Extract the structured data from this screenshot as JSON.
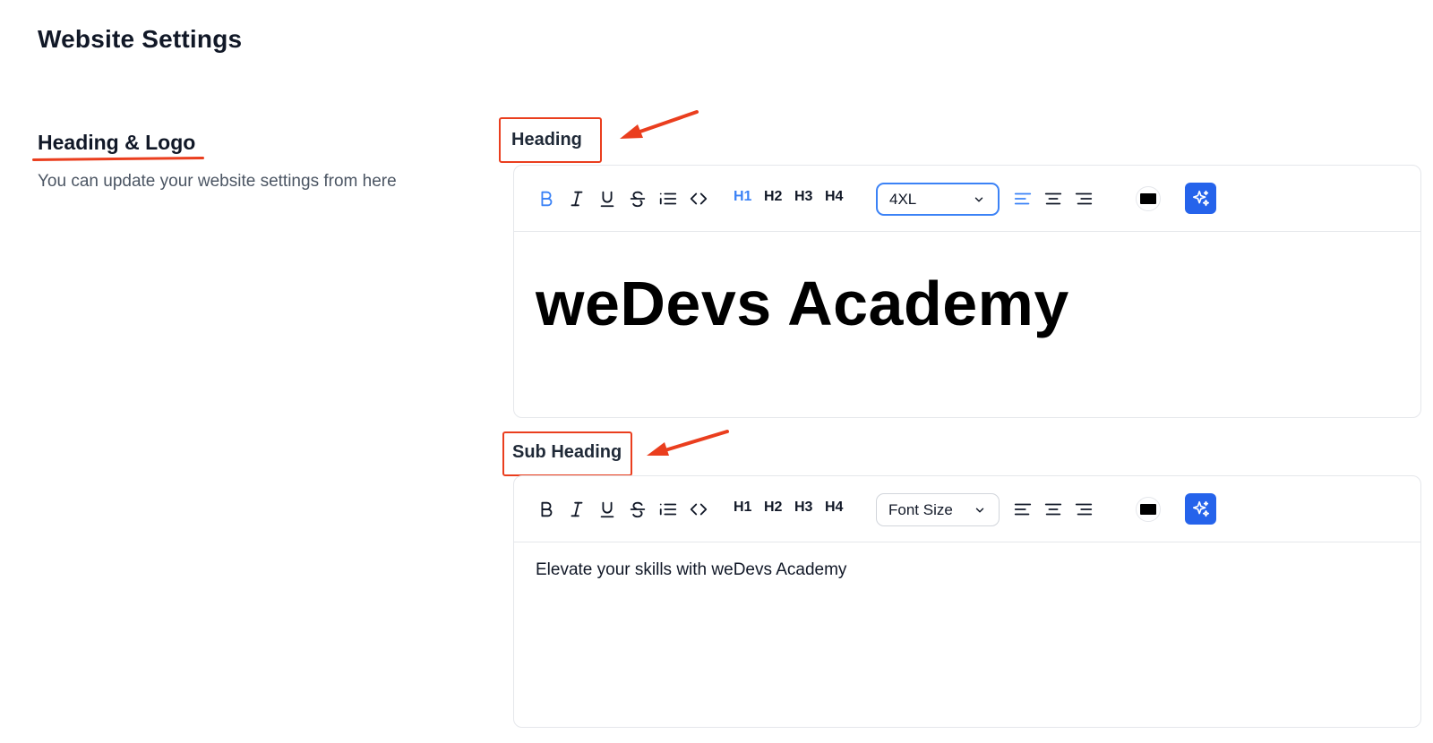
{
  "page": {
    "title": "Website Settings"
  },
  "section": {
    "title": "Heading & Logo",
    "description": "You can update your website settings from here"
  },
  "annotation_color": "#ea3e1e",
  "accent_color": "#3b82f6",
  "heading_field": {
    "label": "Heading",
    "toolbar": {
      "icons": [
        "bold-icon",
        "italic-icon",
        "underline-icon",
        "strikethrough-icon",
        "list-icon",
        "code-icon"
      ],
      "active": [
        "bold",
        "h1",
        "align-left"
      ],
      "headings": [
        "H1",
        "H2",
        "H3",
        "H4"
      ],
      "size_select": {
        "value": "4XL"
      },
      "text_color": "#000000"
    },
    "content": "weDevs Academy"
  },
  "subheading_field": {
    "label": "Sub Heading",
    "toolbar": {
      "icons": [
        "bold-icon",
        "italic-icon",
        "underline-icon",
        "strikethrough-icon",
        "list-icon",
        "code-icon"
      ],
      "headings": [
        "H1",
        "H2",
        "H3",
        "H4"
      ],
      "size_select": {
        "value": "Font Size"
      },
      "text_color": "#000000"
    },
    "content": "Elevate your skills with weDevs Academy"
  }
}
